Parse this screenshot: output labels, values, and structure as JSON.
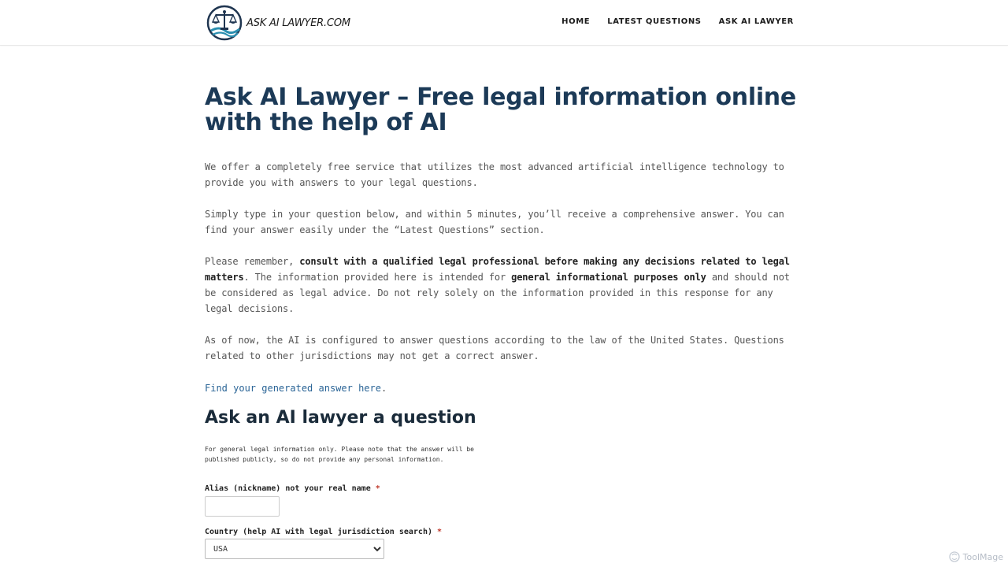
{
  "header": {
    "logo_text": "ASK AI LAWYER.COM",
    "nav": [
      "HOME",
      "LATEST QUESTIONS",
      "ASK AI LAWYER"
    ]
  },
  "main": {
    "title": "Ask AI Lawyer – Free legal information online with the help of AI",
    "paragraphs": {
      "p1": "We offer a completely free service that utilizes the most advanced artificial intelligence technology to provide you with answers to your legal questions.",
      "p2": "Simply type in your question below, and within 5 minutes, you’ll receive a comprehensive answer. You can find your answer easily under the “Latest Questions” section.",
      "p3": {
        "a": "Please remember, ",
        "b": "consult with a qualified legal professional before making any decisions related to legal matters",
        "c": ". The information provided here is intended for ",
        "d": "general informational purposes only",
        "e": " and should not be considered as legal advice. Do not rely solely on the information provided in this response for any legal decisions."
      },
      "p4": "As of now, the AI is configured to answer questions according to the law of the United States. Questions related to other jurisdictions may not get a correct answer."
    },
    "answer_link": "Find your generated answer here",
    "answer_link_suffix": "."
  },
  "form": {
    "title": "Ask an AI lawyer a question",
    "note": "For general legal information only. Please note that the answer will be published publicly, so do not provide any personal information.",
    "alias_label": "Alias (nickname) not your real name",
    "country_label": "Country (help AI with legal jurisdiction search)",
    "required_mark": "*",
    "alias_value": "",
    "country_selected": "USA"
  },
  "watermark": "ToolMage",
  "colors": {
    "title": "#1c3a57",
    "link": "#2a6496",
    "required": "#c0392b"
  }
}
